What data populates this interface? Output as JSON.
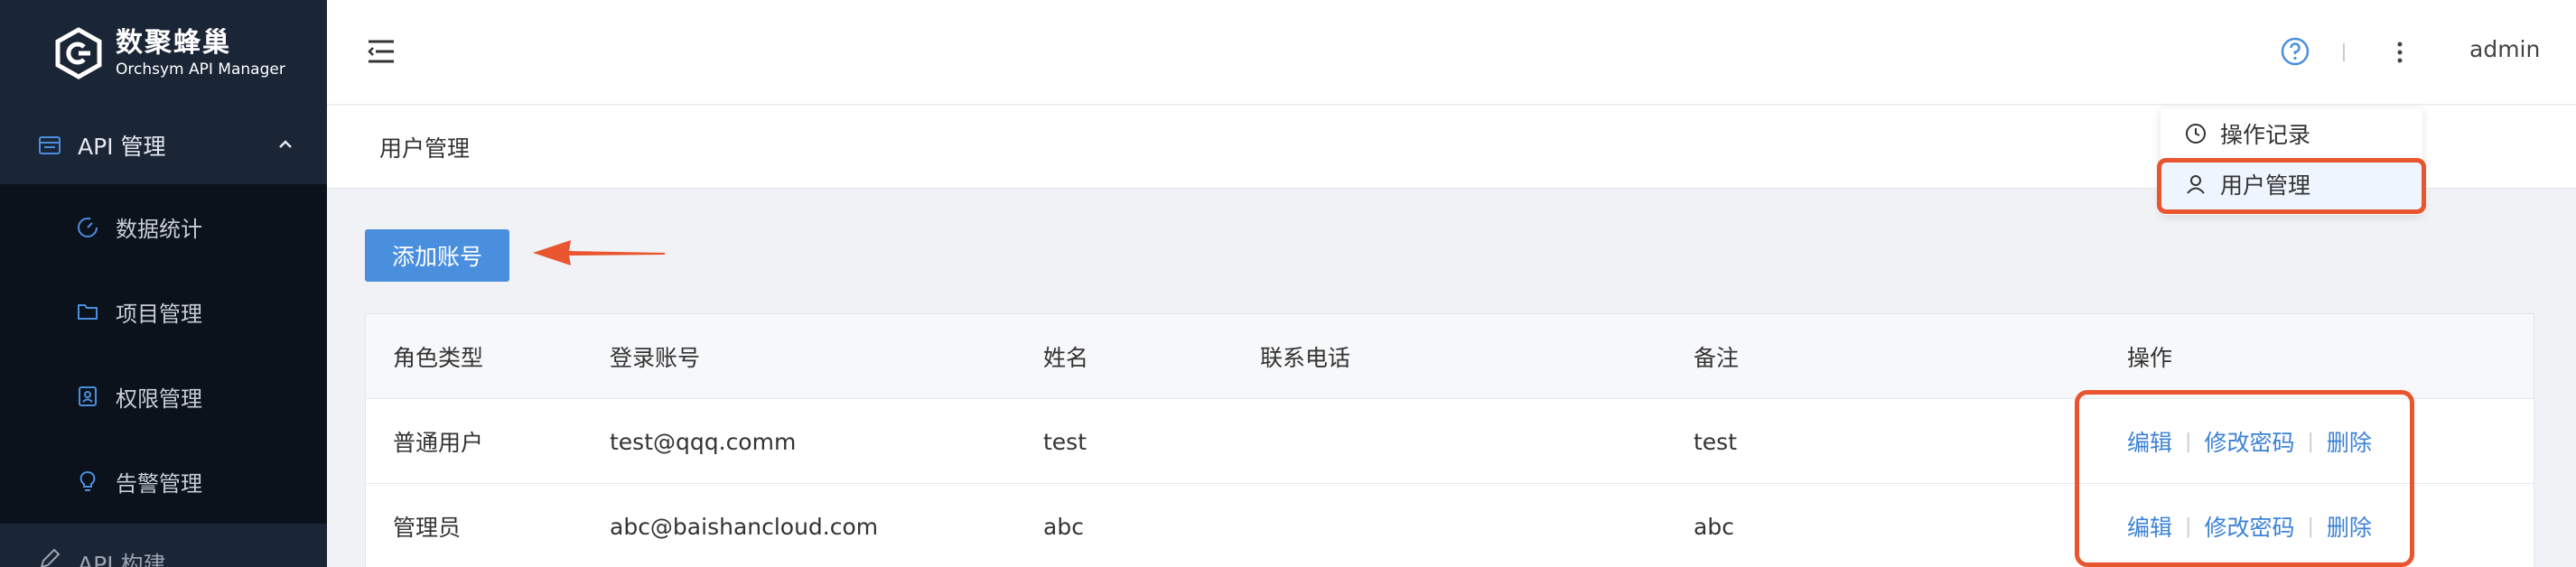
{
  "brand": {
    "title": "数聚蜂巢",
    "subtitle": "Orchsym API Manager"
  },
  "sidebar": {
    "group_api_manage": {
      "label": "API 管理",
      "icon": "list-card-icon",
      "expanded": true
    },
    "items": [
      {
        "label": "数据统计",
        "icon": "dashboard-gauge-icon"
      },
      {
        "label": "项目管理",
        "icon": "folder-icon"
      },
      {
        "label": "权限管理",
        "icon": "user-badge-icon"
      },
      {
        "label": "告警管理",
        "icon": "bulb-icon"
      }
    ],
    "group_api_build": {
      "label": "API 构建",
      "icon": "edit-icon"
    }
  },
  "header": {
    "username": "admin"
  },
  "user_menu": {
    "items": [
      {
        "label": "操作记录",
        "icon": "clock-icon"
      },
      {
        "label": "用户管理",
        "icon": "user-icon"
      }
    ]
  },
  "page": {
    "title": "用户管理",
    "add_button": "添加账号"
  },
  "table": {
    "columns": [
      "角色类型",
      "登录账号",
      "姓名",
      "联系电话",
      "备注",
      "操作"
    ],
    "rows": [
      {
        "role": "普通用户",
        "account": "test@qqq.comm",
        "name": "test",
        "phone": "",
        "note": "test"
      },
      {
        "role": "管理员",
        "account": "abc@baishancloud.com",
        "name": "abc",
        "phone": "",
        "note": "abc"
      }
    ],
    "actions": {
      "edit": "编辑",
      "change_password": "修改密码",
      "delete": "删除"
    }
  },
  "colors": {
    "accent": "#4a8fdd",
    "annotation": "#e8552e",
    "sidebar_bg": "#1a2536",
    "submenu_bg": "#0b121c"
  }
}
